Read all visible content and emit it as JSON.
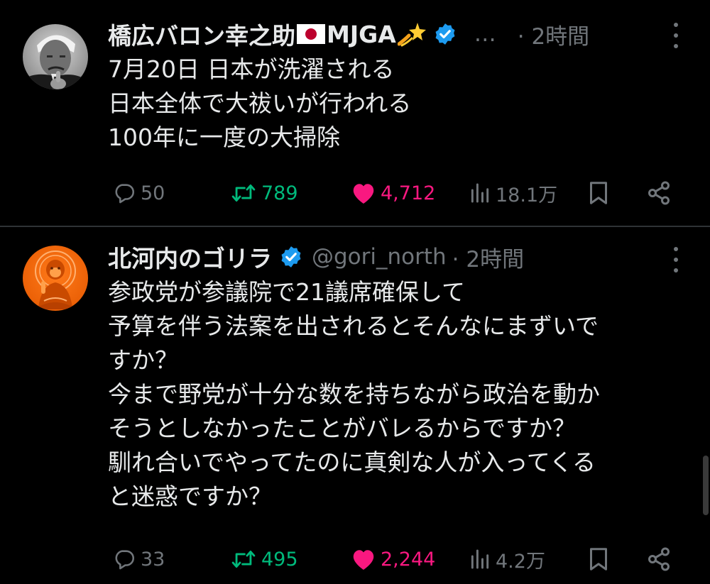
{
  "tweets": [
    {
      "display_name": "橋広バロン幸之助",
      "name_suffix": "MJGA",
      "handle": "…",
      "time": "· 2時間",
      "lines": [
        "7月20日 日本が洗濯される",
        "日本全体で大祓いが行われる",
        "100年に一度の大掃除"
      ],
      "reply_count": "50",
      "retweet_count": "789",
      "like_count": "4,712",
      "view_count": "18.1万"
    },
    {
      "display_name": "北河内のゴリラ",
      "handle": "@gori_north",
      "time": "· 2時間",
      "lines": [
        "参政党が参議院で21議席確保して",
        "予算を伴う法案を出されるとそんなにまずいで",
        "すか？",
        "今まで野党が十分な数を持ちながら政治を動か",
        "そうとしなかったことがバレるからですか？",
        "馴れ合いでやってたのに真剣な人が入ってくる",
        "と迷惑ですか？"
      ],
      "reply_count": "33",
      "retweet_count": "495",
      "like_count": "2,244",
      "view_count": "4.2万"
    }
  ],
  "icons": {
    "reply": "speech-bubble-icon",
    "retweet": "retweet-icon",
    "like": "heart-icon",
    "views": "bar-chart-icon",
    "bookmark": "bookmark-icon",
    "share": "share-icon",
    "verified": "verified-badge-icon",
    "more": "more-vertical-icon",
    "flag": "japan-flag-icon",
    "sparkle": "dizzy-star-icon"
  },
  "colors": {
    "background": "#000000",
    "text": "#e7e9ea",
    "muted": "#71767b",
    "retweet": "#00ba7c",
    "like": "#f91880",
    "verified": "#1d9bf0",
    "divider": "#2f3336"
  }
}
